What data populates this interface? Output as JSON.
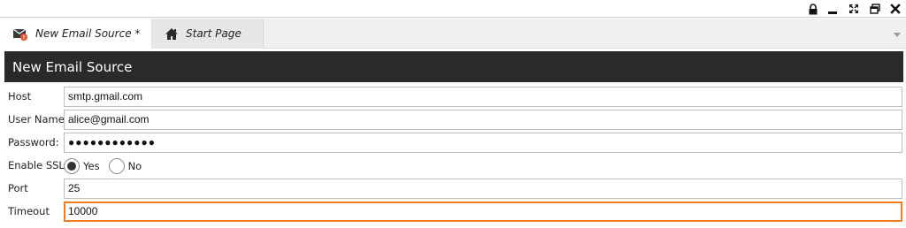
{
  "window_controls": {
    "lock_icon": "lock-icon",
    "minimize_icon": "minimize-icon",
    "expand_icon": "expand-icon",
    "restore_icon": "restore-icon",
    "close_icon": "close-icon"
  },
  "tabs": [
    {
      "label": "New Email Source *",
      "icon": "email-source-icon",
      "active": true
    },
    {
      "label": "Start Page",
      "icon": "home-icon",
      "active": false
    }
  ],
  "header": {
    "title": "New Email Source"
  },
  "form": {
    "host": {
      "label": "Host",
      "value": "smtp.gmail.com"
    },
    "username": {
      "label": "User Name:",
      "value": "alice@gmail.com"
    },
    "password": {
      "label": "Password:",
      "value": "●●●●●●●●●●●●"
    },
    "ssl": {
      "label": "Enable SSL",
      "yes_label": "Yes",
      "no_label": "No",
      "selected": "Yes"
    },
    "port": {
      "label": "Port",
      "value": "25"
    },
    "timeout": {
      "label": "Timeout",
      "value": "10000"
    }
  },
  "colors": {
    "header_bg": "#2b2a29",
    "focus_border": "#f07d20",
    "email_icon_accent": "#e4572e"
  }
}
